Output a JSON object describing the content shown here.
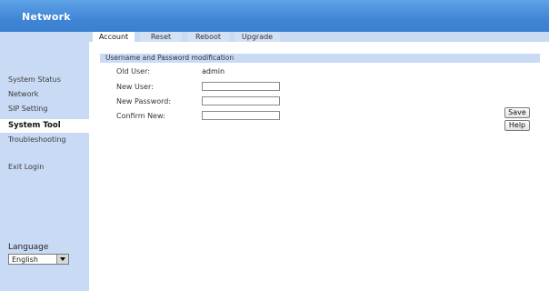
{
  "header": {
    "brand": "Network"
  },
  "tabs": [
    {
      "label": "Account",
      "active": true
    },
    {
      "label": "Reset",
      "active": false
    },
    {
      "label": "Reboot",
      "active": false
    },
    {
      "label": "Upgrade",
      "active": false
    }
  ],
  "sidebar": {
    "items": [
      {
        "label": "System Status"
      },
      {
        "label": "Network"
      },
      {
        "label": "SIP Setting"
      },
      {
        "label": "System Tool",
        "active": true
      },
      {
        "label": "Troubleshooting"
      },
      {
        "label": "Exit Login"
      }
    ],
    "language_label": "Language",
    "language_value": "English"
  },
  "section": {
    "title": "Username and Password modification",
    "fields": {
      "old_user_label": "Old User:",
      "old_user_value": "admin",
      "new_user_label": "New User:",
      "new_password_label": "New Password:",
      "confirm_label": "Confirm New:"
    }
  },
  "buttons": {
    "save": "Save",
    "help": "Help"
  },
  "colors": {
    "topbar": "#3f86d6",
    "sidebar": "#c9daf5",
    "section_header": "#c9daf5"
  }
}
